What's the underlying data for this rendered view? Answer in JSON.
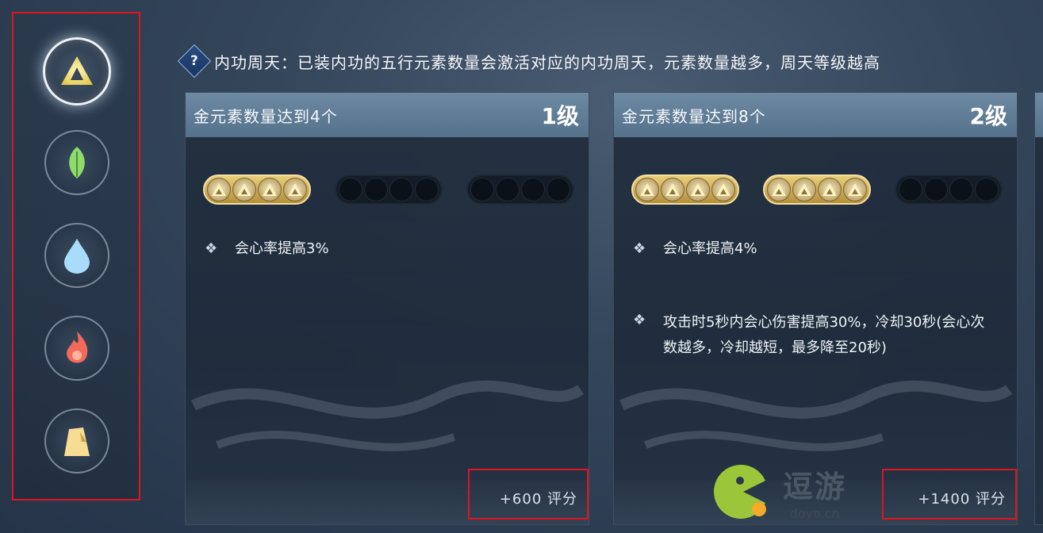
{
  "hint": {
    "icon": "question-diamond-icon",
    "text": "内功周天：已装内功的五行元素数量会激活对应的内功周天，元素数量越多，周天等级越高"
  },
  "sidebar": {
    "items": [
      {
        "name": "metal",
        "icon": "metal-triangle-icon",
        "color": "#f2e27a",
        "active": true
      },
      {
        "name": "wood",
        "icon": "wood-leaf-icon",
        "color": "#8fdc6c",
        "active": false
      },
      {
        "name": "water",
        "icon": "water-drop-icon",
        "color": "#8ecff6",
        "active": false
      },
      {
        "name": "fire",
        "icon": "fire-flame-icon",
        "color": "#f26a5a",
        "active": false
      },
      {
        "name": "earth",
        "icon": "earth-rock-icon",
        "color": "#f5d78a",
        "active": false
      }
    ]
  },
  "cards": [
    {
      "title": "金元素数量达到4个",
      "level": "1级",
      "gem_groups_filled": [
        true,
        false,
        false
      ],
      "effects": [
        "会心率提高3%"
      ],
      "score": "+600  评分"
    },
    {
      "title": "金元素数量达到8个",
      "level": "2级",
      "gem_groups_filled": [
        true,
        true,
        false
      ],
      "effects": [
        "会心率提高4%",
        "攻击时5秒内会心伤害提高30%，冷却30秒(会心次数越多，冷却越短，最多降至20秒)"
      ],
      "score": "+1400  评分"
    }
  ],
  "watermark": {
    "big": "逗游",
    "small": "doyo.cn"
  },
  "colors": {
    "highlight_border": "#e0141c",
    "gem_gold": "#e9cf7a",
    "header_blue": "#6d8aa3"
  }
}
